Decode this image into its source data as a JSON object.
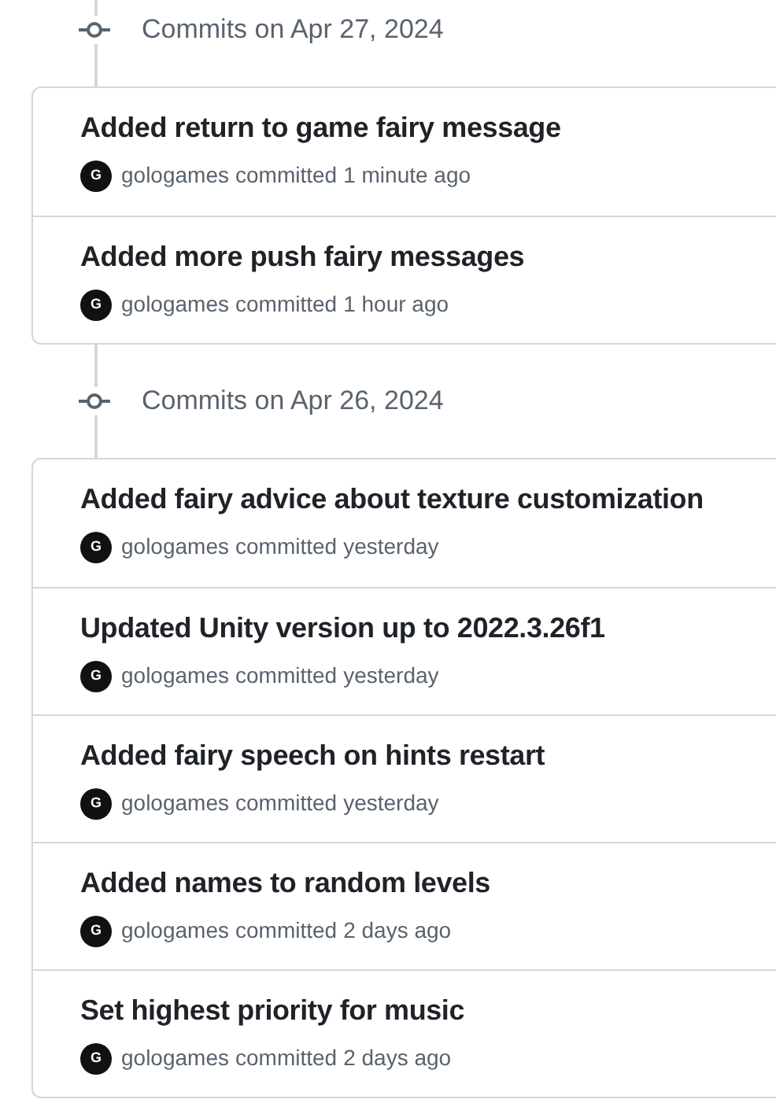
{
  "groups": [
    {
      "heading": "Commits on Apr 27, 2024",
      "commits": [
        {
          "title": "Added return to game fairy message",
          "avatar_letter": "G",
          "author": "gologames",
          "action": "committed",
          "time": "1 minute ago"
        },
        {
          "title": "Added more push fairy messages",
          "avatar_letter": "G",
          "author": "gologames",
          "action": "committed",
          "time": "1 hour ago"
        }
      ]
    },
    {
      "heading": "Commits on Apr 26, 2024",
      "commits": [
        {
          "title": "Added fairy advice about texture customization",
          "avatar_letter": "G",
          "author": "gologames",
          "action": "committed",
          "time": "yesterday"
        },
        {
          "title": "Updated Unity version up to 2022.3.26f1",
          "avatar_letter": "G",
          "author": "gologames",
          "action": "committed",
          "time": "yesterday"
        },
        {
          "title": "Added fairy speech on hints restart",
          "avatar_letter": "G",
          "author": "gologames",
          "action": "committed",
          "time": "yesterday"
        },
        {
          "title": "Added names to random levels",
          "avatar_letter": "G",
          "author": "gologames",
          "action": "committed",
          "time": "2 days ago"
        },
        {
          "title": "Set highest priority for music",
          "avatar_letter": "G",
          "author": "gologames",
          "action": "committed",
          "time": "2 days ago"
        }
      ]
    }
  ]
}
